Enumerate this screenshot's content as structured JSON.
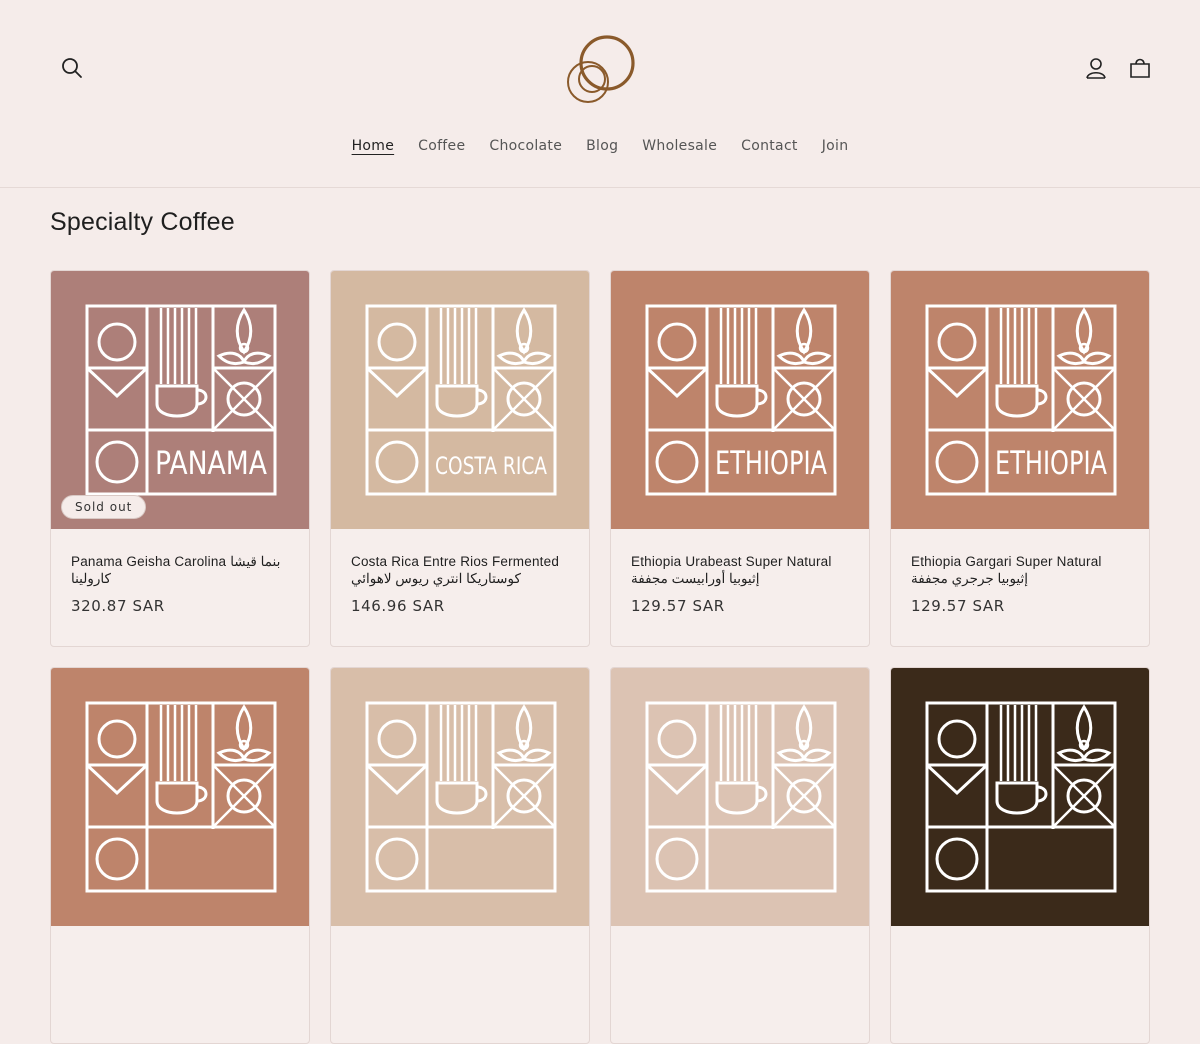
{
  "header": {
    "nav": [
      {
        "label": "Home",
        "active": true
      },
      {
        "label": "Coffee",
        "active": false
      },
      {
        "label": "Chocolate",
        "active": false
      },
      {
        "label": "Blog",
        "active": false
      },
      {
        "label": "Wholesale",
        "active": false
      },
      {
        "label": "Contact",
        "active": false
      },
      {
        "label": "Join",
        "active": false
      }
    ],
    "icons": {
      "search": "search-icon",
      "account": "user-icon",
      "cart": "cart-icon",
      "logo": "rings-logo"
    }
  },
  "section": {
    "title": "Specialty Coffee"
  },
  "colors": {
    "page_bg": "#f5ecea",
    "logo": "#8a5a2b"
  },
  "products": [
    {
      "title": "Panama Geisha Carolina بنما قيشا كارولينا",
      "price": "320.87 SAR",
      "badge": "Sold out",
      "bg": "#ad7f79",
      "label": "PANAMA"
    },
    {
      "title": "Costa Rica Entre Rios Fermented كوستاريكا انتري ريوس لاهوائي",
      "price": "146.96 SAR",
      "badge": "",
      "bg": "#d4b9a1",
      "label": "COSTA RICA"
    },
    {
      "title": "Ethiopia Urabeast Super Natural إثيوبيا أورابيست مجففة",
      "price": "129.57 SAR",
      "badge": "",
      "bg": "#be846b",
      "label": "ETHIOPIA"
    },
    {
      "title": "Ethiopia Gargari Super Natural إثيوبيا جرجري مجففة",
      "price": "129.57 SAR",
      "badge": "",
      "bg": "#be846b",
      "label": "ETHIOPIA"
    },
    {
      "title": "",
      "price": "",
      "badge": "",
      "bg": "#be846b",
      "label": ""
    },
    {
      "title": "",
      "price": "",
      "badge": "",
      "bg": "#d8bea9",
      "label": ""
    },
    {
      "title": "",
      "price": "",
      "badge": "",
      "bg": "#dcc3b3",
      "label": ""
    },
    {
      "title": "",
      "price": "",
      "badge": "",
      "bg": "#3b2a1a",
      "label": ""
    }
  ]
}
